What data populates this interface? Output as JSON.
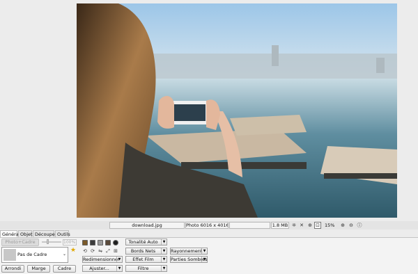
{
  "statusbar": {
    "filename": "download.jpg",
    "dimensions": "Photo 6016 x 4016",
    "filesize": "1.8 MB",
    "zoom": "15%"
  },
  "tabs": [
    {
      "label": "Général",
      "active": true
    },
    {
      "label": "Objet",
      "active": false
    },
    {
      "label": "Découper",
      "active": false
    },
    {
      "label": "Outils",
      "active": false
    }
  ],
  "panel": {
    "photo_frame_button": "Photo+Cadre",
    "opacity_value": "100%",
    "frame_selector": "Pas de Cadre",
    "round_button": "Arrondi",
    "margin_button": "Marge",
    "frame_button": "Cadre",
    "resize_dropdown": "Redimensionner",
    "adjust_dropdown": "Ajuster...",
    "auto_tone_dropdown": "Tonalité Auto",
    "sharp_edges_dropdown": "Bords Nets",
    "film_effect_dropdown": "Effet Film",
    "filter_dropdown": "Filtre",
    "radiance_dropdown": "Rayonnement",
    "dark_parts_dropdown": "Parties Sombres"
  },
  "swatch_colors": [
    "#7a5a2a",
    "#3c3c3c",
    "#9a9a9a",
    "#5a4a3a",
    "#1e1e1e"
  ],
  "icons": {
    "fit": "fit-to-window-icon",
    "fullscreen": "fullscreen-icon",
    "zoom_in": "zoom-in-icon",
    "zoom_out": "zoom-out-icon",
    "info": "info-icon",
    "star": "favorite-star-icon"
  }
}
